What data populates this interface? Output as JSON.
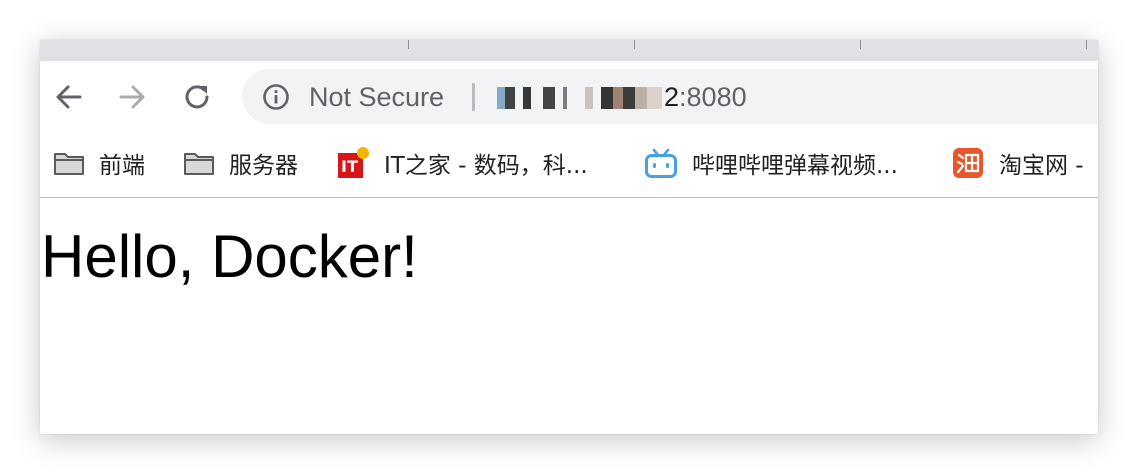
{
  "toolbar": {
    "back_icon": "arrow-left-icon",
    "forward_icon": "arrow-right-icon",
    "reload_icon": "reload-icon"
  },
  "omnibox": {
    "security_icon": "info-icon",
    "security_text": "Not Secure",
    "url_visible_tail": "2",
    "url_port": ":8080"
  },
  "bookmarks": [
    {
      "label": "前端",
      "icon": "folder-icon"
    },
    {
      "label": "服务器",
      "icon": "folder-icon"
    },
    {
      "label": "IT之家 - 数码，科...",
      "icon": "ithome-icon"
    },
    {
      "label": "哔哩哔哩弹幕视频...",
      "icon": "bilibili-icon"
    },
    {
      "label": "淘宝网 -",
      "icon": "taobao-icon"
    }
  ],
  "page": {
    "heading": "Hello, Docker!"
  },
  "colors": {
    "tabstrip": "#dfe1e5",
    "omnibox_bg": "#f1f3f4",
    "muted_text": "#5f6368",
    "ithome_red": "#d7141a",
    "ithome_badge": "#f5b400",
    "bilibili_blue": "#4a9fde",
    "taobao_orange": "#e8562a"
  }
}
